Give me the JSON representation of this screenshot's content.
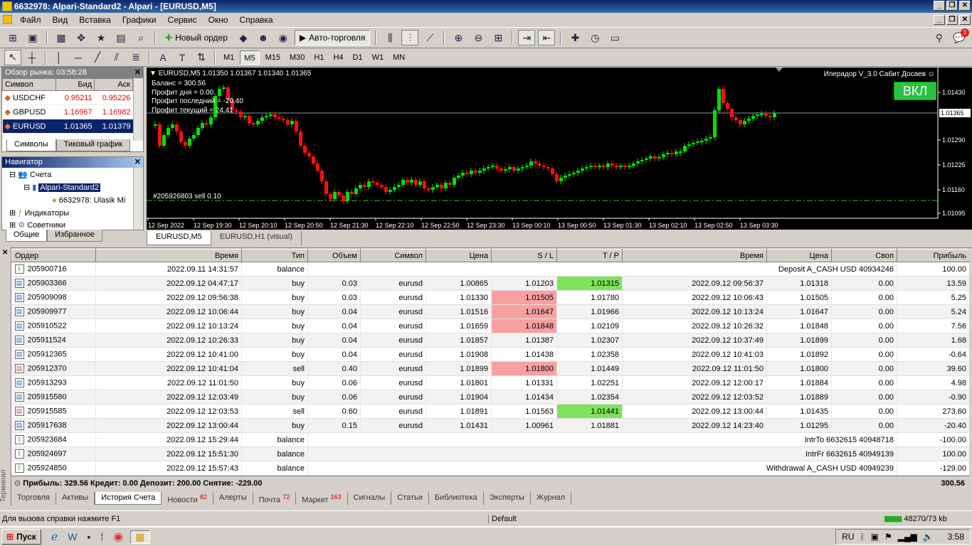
{
  "window": {
    "title": "6632978: Alpari-Standard2 - Alpari - [EURUSD,M5]"
  },
  "menu": [
    "Файл",
    "Вид",
    "Вставка",
    "Графики",
    "Сервис",
    "Окно",
    "Справка"
  ],
  "toolbar": {
    "new_order": "Новый ордер",
    "autotrading": "Авто-торговля"
  },
  "timeframes": [
    "M1",
    "M5",
    "M15",
    "M30",
    "H1",
    "H4",
    "D1",
    "W1",
    "MN"
  ],
  "timeframe_active": "M5",
  "market_watch": {
    "title": "Обзор рынка: 03:58:28",
    "columns": [
      "Символ",
      "Бид",
      "Аск"
    ],
    "rows": [
      {
        "symbol": "USDCHF",
        "bid": "0.95211",
        "ask": "0.95226"
      },
      {
        "symbol": "GBPUSD",
        "bid": "1.16967",
        "ask": "1.16982"
      },
      {
        "symbol": "EURUSD",
        "bid": "1.01365",
        "ask": "1.01379"
      }
    ],
    "tabs": [
      "Символы",
      "Тиковый график"
    ]
  },
  "navigator": {
    "title": "Навигатор",
    "items": [
      "Счета",
      "Alpari-Standard2",
      "6632978: Ulasik Mi",
      "Индикаторы",
      "Советники"
    ],
    "tabs": [
      "Общие",
      "Избранное"
    ]
  },
  "chart": {
    "header": "EURUSD,M5  1.01350 1.01367 1.01340 1.01365",
    "info": [
      "Баланс = 300.56",
      "Профит дня = 0.00",
      "Профит последний = -20.40",
      "Профит текущий = 24.41"
    ],
    "ea_label": "Иперадор V_3.0 Сабит Досаев ☺",
    "on_button": "ВКЛ",
    "order_label": "#205926803 sell 0.10",
    "current_price": "1.01365",
    "y_ticks": [
      "1.01430",
      "1.01290",
      "1.01225",
      "1.01160",
      "1.01095"
    ],
    "x_ticks": [
      "12 Sep 2022",
      "12 Sep 19:30",
      "12 Sep 20:10",
      "12 Sep 20:50",
      "12 Sep 21:30",
      "12 Sep 22:10",
      "12 Sep 22:50",
      "12 Sep 23:30",
      "13 Sep 00:10",
      "13 Sep 00:50",
      "13 Sep 01:30",
      "13 Sep 02:10",
      "13 Sep 02:50",
      "13 Sep 03:30"
    ],
    "tabs": [
      "EURUSD,M5",
      "EURUSD,H1 (visual)"
    ]
  },
  "terminal": {
    "side_label": "Терминал",
    "columns": [
      "Ордер",
      "Время",
      "Тип",
      "Объем",
      "Символ",
      "Цена",
      "S / L",
      "T / P",
      "Время",
      "Цена",
      "Своп",
      "Прибыль"
    ],
    "rows": [
      {
        "order": "205900716",
        "time": "2022.09.11 14:31:57",
        "type": "balance",
        "comment": "Deposit A_CASH USD 40934246",
        "profit": "100.00"
      },
      {
        "order": "205903366",
        "time": "2022.09.12 04:47:17",
        "type": "buy",
        "volume": "0.03",
        "symbol": "eurusd",
        "price": "1.00865",
        "sl": "1.01203",
        "tp": "1.01315",
        "ctime": "2022.09.12 09:56:37",
        "cprice": "1.01318",
        "swap": "0.00",
        "profit": "13.59",
        "hl": "tp"
      },
      {
        "order": "205909098",
        "time": "2022.09.12 09:56:38",
        "type": "buy",
        "volume": "0.03",
        "symbol": "eurusd",
        "price": "1.01330",
        "sl": "1.01505",
        "tp": "1.01780",
        "ctime": "2022.09.12 10:06:43",
        "cprice": "1.01505",
        "swap": "0.00",
        "profit": "5.25",
        "hl": "sl"
      },
      {
        "order": "205909977",
        "time": "2022.09.12 10:06:44",
        "type": "buy",
        "volume": "0.04",
        "symbol": "eurusd",
        "price": "1.01516",
        "sl": "1.01647",
        "tp": "1.01966",
        "ctime": "2022.09.12 10:13:24",
        "cprice": "1.01647",
        "swap": "0.00",
        "profit": "5.24",
        "hl": "sl"
      },
      {
        "order": "205910522",
        "time": "2022.09.12 10:13:24",
        "type": "buy",
        "volume": "0.04",
        "symbol": "eurusd",
        "price": "1.01659",
        "sl": "1.01848",
        "tp": "1.02109",
        "ctime": "2022.09.12 10:26:32",
        "cprice": "1.01848",
        "swap": "0.00",
        "profit": "7.56",
        "hl": "sl"
      },
      {
        "order": "205911524",
        "time": "2022.09.12 10:26:33",
        "type": "buy",
        "volume": "0.04",
        "symbol": "eurusd",
        "price": "1.01857",
        "sl": "1.01387",
        "tp": "1.02307",
        "ctime": "2022.09.12 10:37:49",
        "cprice": "1.01899",
        "swap": "0.00",
        "profit": "1.68",
        "hl": ""
      },
      {
        "order": "205912365",
        "time": "2022.09.12 10:41:00",
        "type": "buy",
        "volume": "0.04",
        "symbol": "eurusd",
        "price": "1.01908",
        "sl": "1.01438",
        "tp": "1.02358",
        "ctime": "2022.09.12 10:41:03",
        "cprice": "1.01892",
        "swap": "0.00",
        "profit": "-0.64",
        "hl": ""
      },
      {
        "order": "205912370",
        "time": "2022.09.12 10:41:04",
        "type": "sell",
        "volume": "0.40",
        "symbol": "eurusd",
        "price": "1.01899",
        "sl": "1.01800",
        "tp": "1.01449",
        "ctime": "2022.09.12 11:01:50",
        "cprice": "1.01800",
        "swap": "0.00",
        "profit": "39.60",
        "hl": "sl"
      },
      {
        "order": "205913293",
        "time": "2022.09.12 11:01:50",
        "type": "buy",
        "volume": "0.06",
        "symbol": "eurusd",
        "price": "1.01801",
        "sl": "1.01331",
        "tp": "1.02251",
        "ctime": "2022.09.12 12:00:17",
        "cprice": "1.01884",
        "swap": "0.00",
        "profit": "4.98",
        "hl": ""
      },
      {
        "order": "205915580",
        "time": "2022.09.12 12:03:49",
        "type": "buy",
        "volume": "0.06",
        "symbol": "eurusd",
        "price": "1.01904",
        "sl": "1.01434",
        "tp": "1.02354",
        "ctime": "2022.09.12 12:03:52",
        "cprice": "1.01889",
        "swap": "0.00",
        "profit": "-0.90",
        "hl": ""
      },
      {
        "order": "205915585",
        "time": "2022.09.12 12:03:53",
        "type": "sell",
        "volume": "0.60",
        "symbol": "eurusd",
        "price": "1.01891",
        "sl": "1.01563",
        "tp": "1.01441",
        "ctime": "2022.09.12 13:00:44",
        "cprice": "1.01435",
        "swap": "0.00",
        "profit": "273.60",
        "hl": "tp"
      },
      {
        "order": "205917638",
        "time": "2022.09.12 13:00:44",
        "type": "buy",
        "volume": "0.15",
        "symbol": "eurusd",
        "price": "1.01431",
        "sl": "1.00961",
        "tp": "1.01881",
        "ctime": "2022.09.12 14:23:40",
        "cprice": "1.01295",
        "swap": "0.00",
        "profit": "-20.40",
        "hl": ""
      },
      {
        "order": "205923684",
        "time": "2022.09.12 15:29:44",
        "type": "balance",
        "comment": "IntrTo 6632615 40948718",
        "profit": "-100.00"
      },
      {
        "order": "205924697",
        "time": "2022.09.12 15:51:30",
        "type": "balance",
        "comment": "IntrFr 6632615 40949139",
        "profit": "100.00"
      },
      {
        "order": "205924850",
        "time": "2022.09.12 15:57:43",
        "type": "balance",
        "comment": "Withdrawal A_CASH USD 40949239",
        "profit": "-129.00"
      }
    ],
    "summary": "Прибыль: 329.56  Кредит: 0.00  Депозит: 200.00  Снятие: -229.00",
    "summary_total": "300.56",
    "tabs": [
      {
        "label": "Торговля",
        "badge": ""
      },
      {
        "label": "Активы",
        "badge": ""
      },
      {
        "label": "История Счета",
        "badge": ""
      },
      {
        "label": "Новости",
        "badge": "82"
      },
      {
        "label": "Алерты",
        "badge": ""
      },
      {
        "label": "Почта",
        "badge": "72"
      },
      {
        "label": "Маркет",
        "badge": "163"
      },
      {
        "label": "Сигналы",
        "badge": ""
      },
      {
        "label": "Статьи",
        "badge": ""
      },
      {
        "label": "Библиотека",
        "badge": ""
      },
      {
        "label": "Эксперты",
        "badge": ""
      },
      {
        "label": "Журнал",
        "badge": ""
      }
    ],
    "active_tab": "История Счета"
  },
  "statusbar": {
    "help": "Для вызова справки нажмите F1",
    "profile": "Default",
    "traffic": "48270/73 kb"
  },
  "taskbar": {
    "start": "Пуск",
    "lang": "RU",
    "clock": "3:58"
  },
  "notification_badge": "1"
}
